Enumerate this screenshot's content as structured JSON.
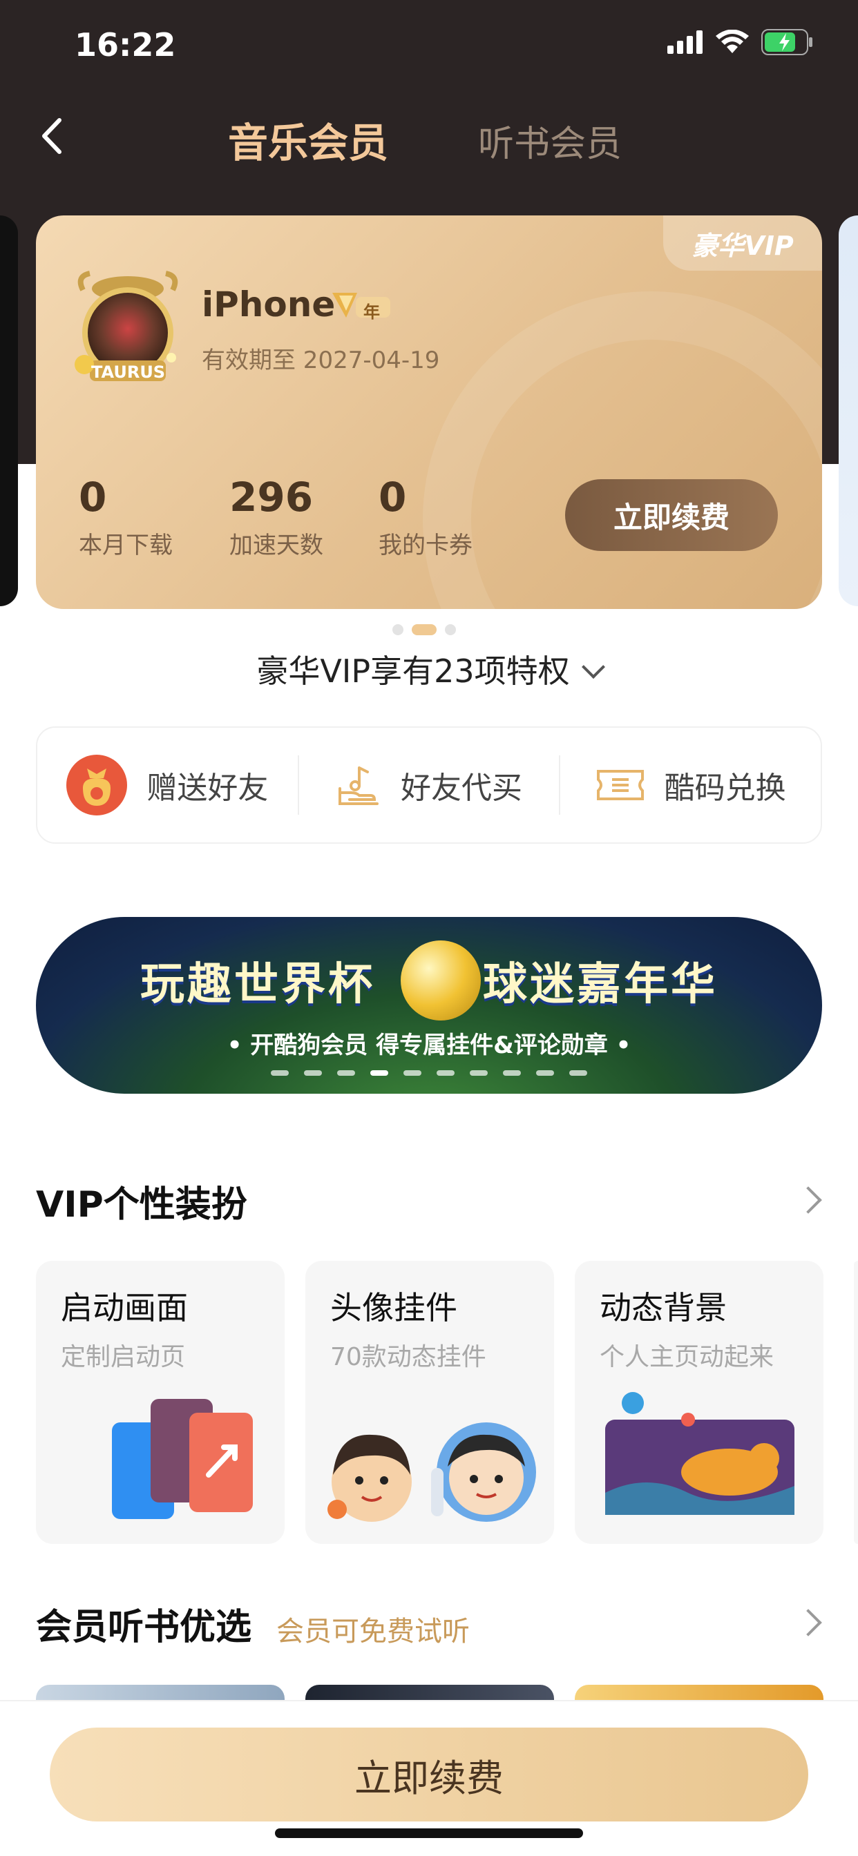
{
  "status_bar": {
    "time": "16:22"
  },
  "nav": {
    "tabs": [
      {
        "label": "音乐会员",
        "active": true
      },
      {
        "label": "听书会员",
        "active": false
      }
    ]
  },
  "vip_card": {
    "badge": "豪华VIP",
    "avatar_label": "TAURUS",
    "user_name": "iPhone",
    "year_badge": "年",
    "expiry": "有效期至 2027-04-19",
    "stats": [
      {
        "value": "0",
        "label": "本月下载"
      },
      {
        "value": "296",
        "label": "加速天数"
      },
      {
        "value": "0",
        "label": "我的卡券"
      }
    ],
    "renew_label": "立即续费"
  },
  "privilege_text": "豪华VIP享有23项特权",
  "actions": [
    {
      "label": "赠送好友",
      "icon": "gift-bag-icon"
    },
    {
      "label": "好友代买",
      "icon": "hand-coin-icon"
    },
    {
      "label": "酷码兑换",
      "icon": "ticket-icon"
    }
  ],
  "banner": {
    "title_left": "玩趣世界杯",
    "title_right": "球迷嘉年华",
    "subtitle": "• 开酷狗会员  得专属挂件&评论勋章 •"
  },
  "dress_section": {
    "title": "VIP个性装扮",
    "cards": [
      {
        "title": "启动画面",
        "subtitle": "定制启动页"
      },
      {
        "title": "头像挂件",
        "subtitle": "70款动态挂件"
      },
      {
        "title": "动态背景",
        "subtitle": "个人主页动起来"
      }
    ]
  },
  "book_section": {
    "title": "会员听书优选",
    "subtitle": "会员可免费试听"
  },
  "bottom_button": "立即续费",
  "colors": {
    "gold_light": "#f4d9b3",
    "gold_dark": "#d9b07c",
    "header_bg": "#2b2424",
    "accent_text": "#c89a5a"
  }
}
